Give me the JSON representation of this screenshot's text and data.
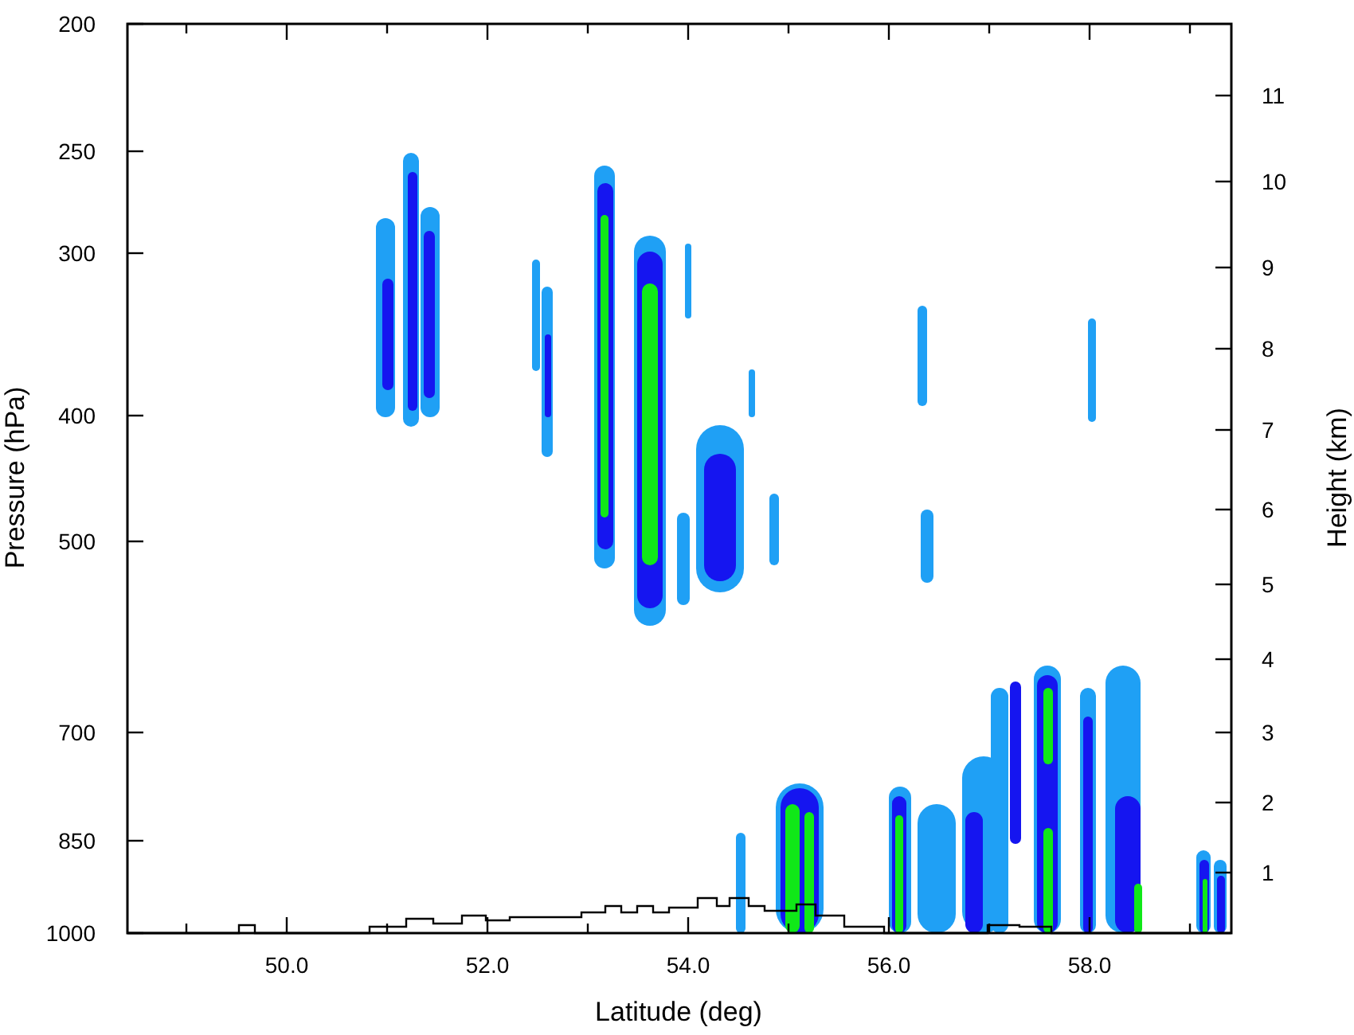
{
  "plot": {
    "xlabel": "Latitude (deg)",
    "ylabel": "Pressure (hPa)",
    "y2label": "Height (km)",
    "xticks": [
      "50.0",
      "52.0",
      "54.0",
      "56.0",
      "58.0"
    ],
    "yticks": [
      "200",
      "250",
      "300",
      "400",
      "500",
      "700",
      "850",
      "1000"
    ],
    "y2ticks": [
      "11",
      "10",
      "9",
      "8",
      "7",
      "6",
      "5",
      "4",
      "3",
      "2",
      "1"
    ]
  }
}
